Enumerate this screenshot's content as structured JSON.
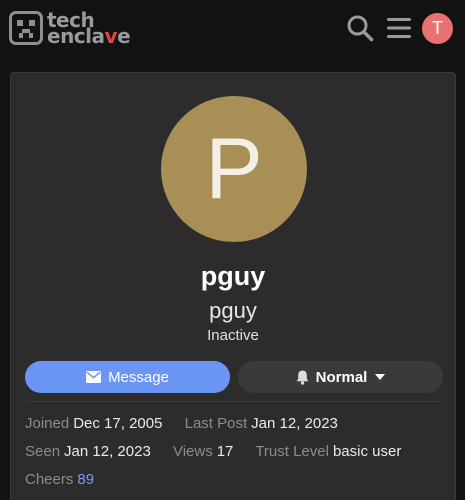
{
  "header": {
    "logo_text_top": "tech",
    "logo_text_bottom_a": "encla",
    "logo_text_bottom_accent": "v",
    "logo_text_bottom_b": "e",
    "avatar_letter": "T",
    "avatar_color": "#e77270"
  },
  "profile": {
    "avatar_letter": "P",
    "avatar_color": "#a78f55",
    "name": "pguy",
    "username": "pguy",
    "status": "Inactive"
  },
  "actions": {
    "message_label": "Message",
    "notification_label": "Normal"
  },
  "stats": {
    "joined_label": "Joined",
    "joined_value": "Dec 17, 2005",
    "last_post_label": "Last Post",
    "last_post_value": "Jan 12, 2023",
    "seen_label": "Seen",
    "seen_value": "Jan 12, 2023",
    "views_label": "Views",
    "views_value": "17",
    "trust_label": "Trust Level",
    "trust_value": "basic user",
    "cheers_label": "Cheers",
    "cheers_value": "89"
  },
  "colors": {
    "accent": "#6b95f5",
    "background": "#121212",
    "card": "#2c2c2c"
  }
}
